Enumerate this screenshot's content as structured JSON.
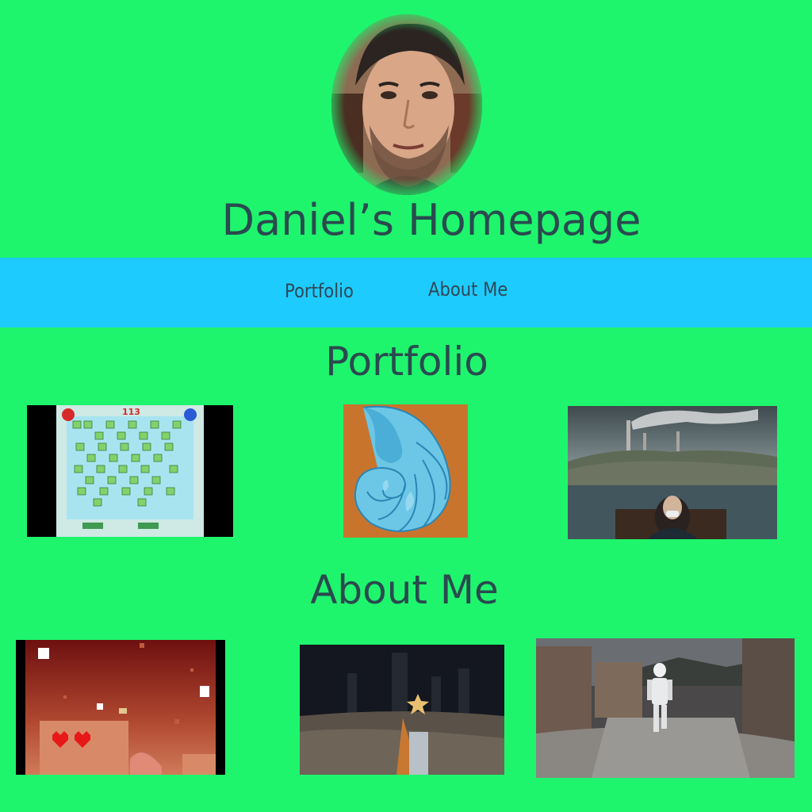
{
  "header": {
    "title": "Daniel’s Homepage"
  },
  "nav": {
    "items": [
      {
        "label": "Portfolio"
      },
      {
        "label": "About Me"
      }
    ]
  },
  "sections": {
    "portfolio_heading": "Portfolio",
    "about_heading": "About Me"
  },
  "portfolio_thumbs": [
    {
      "name": "puzzle-game-screenshot",
      "score": "113"
    },
    {
      "name": "nautilus-shell-art"
    },
    {
      "name": "pollution-landscape-photo"
    }
  ],
  "about_thumbs": [
    {
      "name": "pixel-hearts-game-screenshot"
    },
    {
      "name": "star-runner-game-screenshot"
    },
    {
      "name": "robot-runner-game-screenshot"
    }
  ],
  "colors": {
    "page_background": "#1ef56d",
    "nav_background": "#1ecbff",
    "heading_text": "#2a4a4f"
  }
}
